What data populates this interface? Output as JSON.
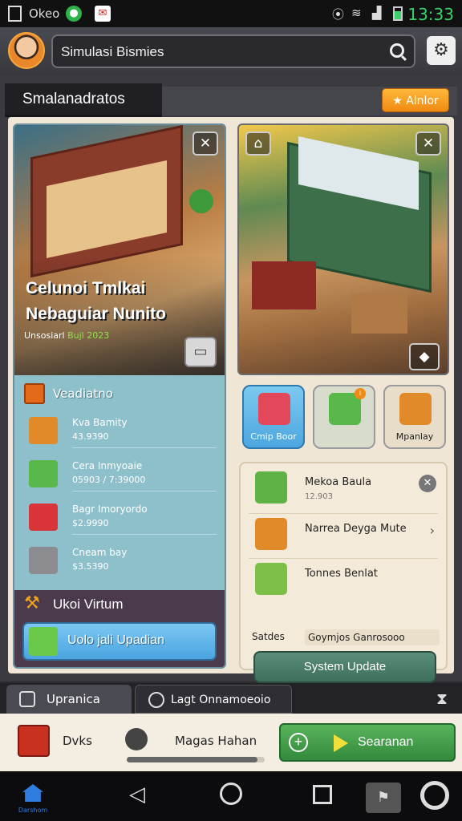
{
  "status_bar": {
    "carrier": "Okeo",
    "time": "13:33"
  },
  "header": {
    "search_value": "Simulasi Bismies"
  },
  "panel": {
    "title": "Smalanadratos",
    "action_label": "Alnlor"
  },
  "hero_left": {
    "title_line1": "Celunoi Tmlkai",
    "title_line2": "Nebaguiar Nunito",
    "sub_label": "Unsosiarl",
    "sub_highlight": "Bujl 2023"
  },
  "list": {
    "heading": "Veadiatno",
    "items": [
      {
        "name": "Kva Bamity",
        "value": "43.9390",
        "color": "#e08a2a"
      },
      {
        "name": "Cera Inmyoaie",
        "value": "05903 / 7:39000",
        "color": "#58b84a"
      },
      {
        "name": "Bagr Imoryordo",
        "value": "$2.9990",
        "color": "#d8343a"
      },
      {
        "name": "Cneam bay",
        "value": "$3.5390",
        "color": "#8c8c90"
      }
    ]
  },
  "upgrade_card": {
    "title": "Ukoi Virtum",
    "button_label": "Uolo jali Upadian"
  },
  "tiles": [
    {
      "label": "Cmip Boor",
      "color": "#e2475a"
    },
    {
      "label": "",
      "color": "#58b84a",
      "badge": "i"
    },
    {
      "label": "Mpanlay",
      "color": "#e08a2a"
    }
  ],
  "right_card": {
    "items": [
      {
        "name": "Mekoa Baula",
        "sub": "12.903",
        "color": "#5fb346"
      },
      {
        "name": "Narrea Deyga Mute",
        "sub": "",
        "color": "#e08a2a"
      },
      {
        "name": "Tonnes Benlat",
        "sub": "",
        "color": "#7cc04a"
      }
    ],
    "field_label": "Satdes",
    "field_value": "Goymjos Ganrosooo",
    "button_label": "System Update"
  },
  "tabs": [
    {
      "label": "Upranica"
    },
    {
      "label": "Lagt Onnamoeoio"
    }
  ],
  "action_bar": {
    "item1_label": "Dvks",
    "item2_label": "Magas Hahan",
    "progress": 0.95,
    "search_label": "Searanan"
  },
  "nav": {
    "home_label": "Darshom"
  }
}
